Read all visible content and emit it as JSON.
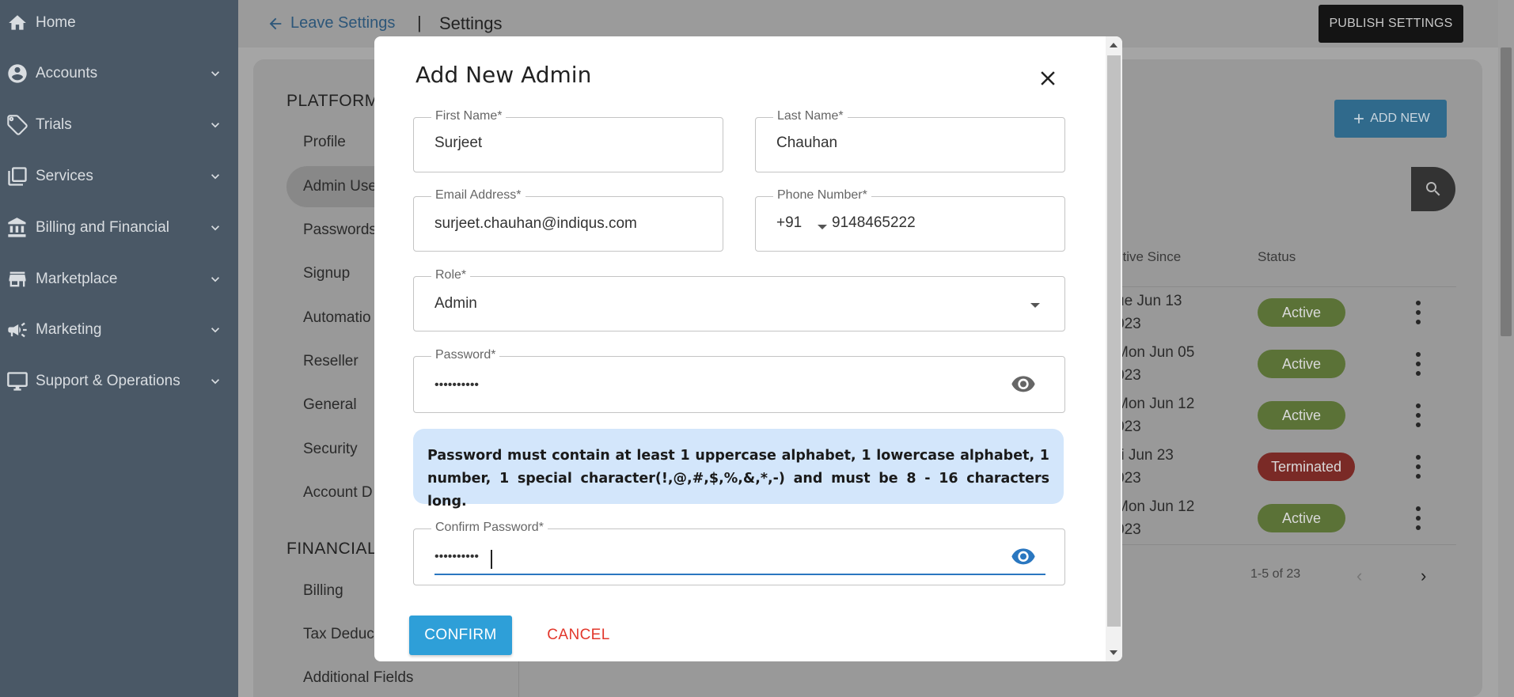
{
  "sidebar": {
    "items": [
      {
        "label": "Home",
        "icon": "home-icon",
        "has_chevron": false
      },
      {
        "label": "Accounts",
        "icon": "account-circle-icon",
        "has_chevron": true
      },
      {
        "label": "Trials",
        "icon": "tag-icon",
        "has_chevron": true
      },
      {
        "label": "Services",
        "icon": "library-icon",
        "has_chevron": true
      },
      {
        "label": "Billing and Financial",
        "icon": "bank-icon",
        "has_chevron": true
      },
      {
        "label": "Marketplace",
        "icon": "store-icon",
        "has_chevron": true
      },
      {
        "label": "Marketing",
        "icon": "megaphone-icon",
        "has_chevron": true
      },
      {
        "label": "Support & Operations",
        "icon": "monitor-icon",
        "has_chevron": true
      }
    ]
  },
  "header": {
    "back_label": "Leave Settings",
    "separator": "|",
    "current": "Settings",
    "publish_label": "PUBLISH SETTINGS"
  },
  "settings_nav": {
    "platform_heading": "PLATFORM",
    "platform_items": [
      "Profile",
      "Admin Use",
      "Passwords",
      "Signup",
      "Automatio",
      "Reseller",
      "General",
      "Security",
      "Account D"
    ],
    "financial_heading": "FINANCIAL",
    "financial_items": [
      "Billing",
      "Tax Deduc",
      "Additional Fields"
    ]
  },
  "admin_table": {
    "add_new_label": "ADD NEW",
    "columns": {
      "active_since": "ctive Since",
      "status": "Status"
    },
    "rows": [
      {
        "date_line1": "ue Jun 13",
        "date_line2": "023",
        "status": "Active"
      },
      {
        "date_line1": "Mon Jun 05",
        "date_line2": "023",
        "status": "Active"
      },
      {
        "date_line1": "Mon Jun 12",
        "date_line2": "023",
        "status": "Active"
      },
      {
        "date_line1": "ri Jun 23",
        "date_line2": "023",
        "status": "Terminated"
      },
      {
        "date_line1": "Mon Jun 12",
        "date_line2": "023",
        "status": "Active"
      }
    ],
    "pagination": "1-5 of 23"
  },
  "modal": {
    "title": "Add New Admin",
    "first_name": {
      "label": "First Name*",
      "value": "Surjeet"
    },
    "last_name": {
      "label": "Last Name*",
      "value": "Chauhan"
    },
    "email": {
      "label": "Email Address*",
      "value": "surjeet.chauhan@indiqus.com"
    },
    "phone": {
      "label": "Phone Number*",
      "code": "+91",
      "value": "9148465222"
    },
    "role": {
      "label": "Role*",
      "value": "Admin"
    },
    "password": {
      "label": "Password*",
      "value": "••••••••••"
    },
    "password_rules": "Password must contain at least 1 uppercase alphabet, 1 lowercase alphabet, 1 number, 1 special character(!,@,#,$,%,&,*,-) and must be 8 - 16 characters long.",
    "confirm_password": {
      "label": "Confirm Password*",
      "value": "••••••••••"
    },
    "confirm_label": "CONFIRM",
    "cancel_label": "CANCEL"
  },
  "colors": {
    "sidebar_bg": "#4a5866",
    "primary": "#2e9fd8",
    "danger": "#e2372b",
    "focus": "#2a77c0",
    "info_bg": "#d3e6fb"
  }
}
